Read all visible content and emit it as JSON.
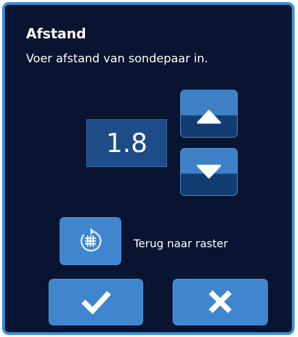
{
  "dialog": {
    "title": "Afstand",
    "subtitle": "Voer afstand van sondepaar in."
  },
  "spacing_input": {
    "value": "1.8"
  },
  "stepper": {
    "up_icon": "triangle-up-icon",
    "down_icon": "triangle-down-icon"
  },
  "reset_grid": {
    "icon": "reset-grid-icon",
    "label": "Terug naar raster"
  },
  "actions": {
    "confirm_icon": "checkmark-icon",
    "cancel_icon": "close-icon"
  },
  "colors": {
    "dialog_background": "#081430",
    "dialog_border": "#3d8fd8",
    "button_blue": "#3f86cf",
    "button_dark_half": "#123d72",
    "value_box": "#1d4c86",
    "text": "#ffffff"
  }
}
